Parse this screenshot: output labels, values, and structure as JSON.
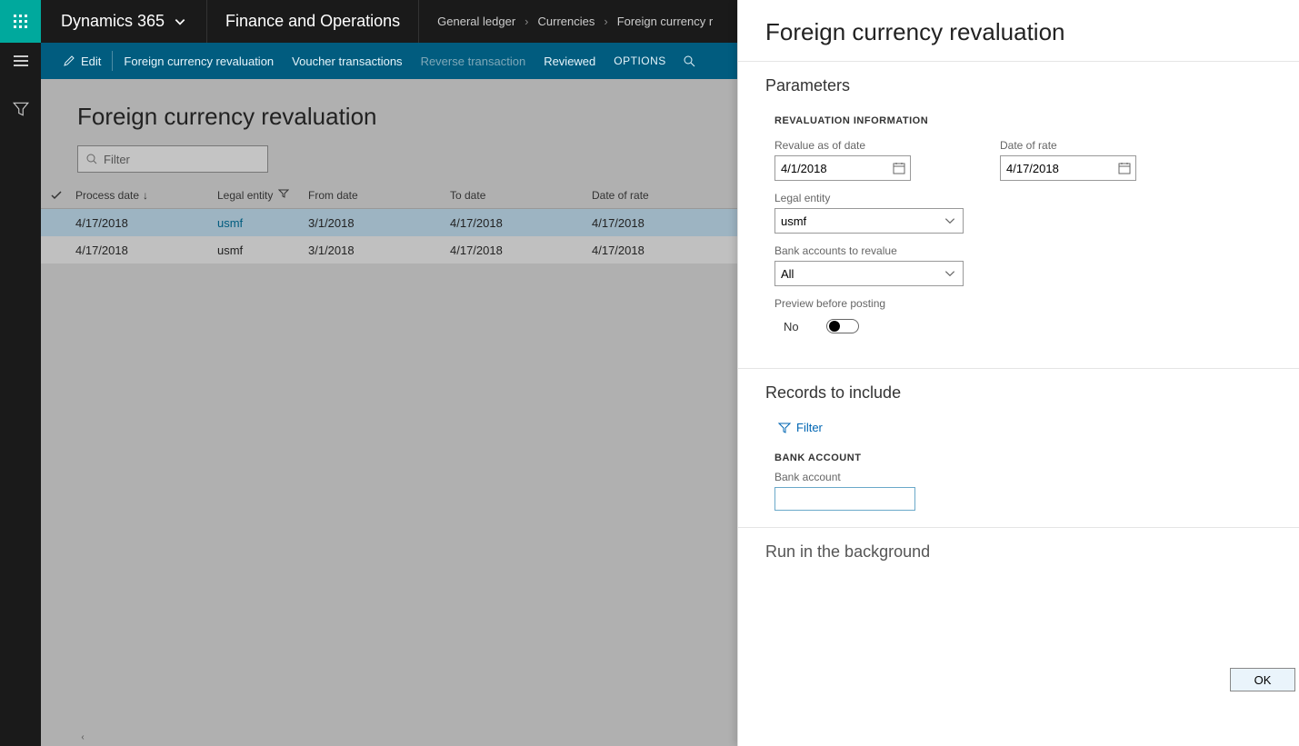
{
  "header": {
    "brand": "Dynamics 365",
    "app": "Finance and Operations",
    "breadcrumb": [
      "General ledger",
      "Currencies",
      "Foreign currency r"
    ]
  },
  "actionbar": {
    "edit": "Edit",
    "fcr": "Foreign currency revaluation",
    "voucher": "Voucher transactions",
    "reverse": "Reverse transaction",
    "reviewed": "Reviewed",
    "options": "OPTIONS"
  },
  "main": {
    "title": "Foreign currency revaluation",
    "filter_placeholder": "Filter",
    "columns": {
      "process": "Process date",
      "legal": "Legal entity",
      "from": "From date",
      "to": "To date",
      "rate": "Date of rate"
    },
    "rows": [
      {
        "process": "4/17/2018",
        "legal": "usmf",
        "from": "3/1/2018",
        "to": "4/17/2018",
        "rate": "4/17/2018",
        "selected": true
      },
      {
        "process": "4/17/2018",
        "legal": "usmf",
        "from": "3/1/2018",
        "to": "4/17/2018",
        "rate": "4/17/2018",
        "selected": false
      }
    ]
  },
  "panel": {
    "title": "Foreign currency revaluation",
    "parameters": "Parameters",
    "group_label": "REVALUATION INFORMATION",
    "revalue_label": "Revalue as of date",
    "revalue_value": "4/1/2018",
    "dor_label": "Date of rate",
    "dor_value": "4/17/2018",
    "legal_label": "Legal entity",
    "legal_value": "usmf",
    "bank_rev_label": "Bank accounts to revalue",
    "bank_rev_value": "All",
    "preview_label": "Preview before posting",
    "preview_value": "No",
    "records": "Records to include",
    "filter": "Filter",
    "bank_group": "BANK ACCOUNT",
    "bank_label": "Bank account",
    "background": "Run in the background",
    "ok": "OK"
  }
}
